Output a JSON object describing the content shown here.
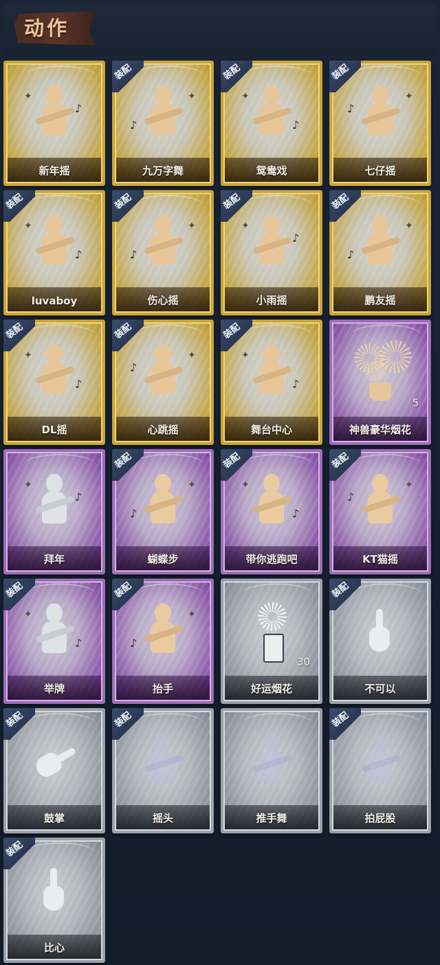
{
  "header": {
    "title": "动作"
  },
  "equip_label": "装配",
  "cards": [
    {
      "name": "新年摇",
      "rarity": "gold",
      "equipped": false,
      "icon": "figure-hands-chest-icon"
    },
    {
      "name": "九万字舞",
      "rarity": "gold",
      "equipped": true,
      "icon": "figure-swirl-icon"
    },
    {
      "name": "鸳鸯戏",
      "rarity": "gold",
      "equipped": true,
      "icon": "figure-arm-out-icon"
    },
    {
      "name": "七仔摇",
      "rarity": "gold",
      "equipped": true,
      "icon": "figure-fist-icon"
    },
    {
      "name": "luvaboy",
      "rarity": "gold",
      "equipped": true,
      "icon": "figure-cross-arms-icon"
    },
    {
      "name": "伤心摇",
      "rarity": "gold",
      "equipped": true,
      "icon": "figure-heart-hands-icon"
    },
    {
      "name": "小雨摇",
      "rarity": "gold",
      "equipped": true,
      "icon": "figure-arm-out-icon"
    },
    {
      "name": "鹏友摇",
      "rarity": "gold",
      "equipped": true,
      "icon": "figure-point-icon"
    },
    {
      "name": "DL摇",
      "rarity": "gold",
      "equipped": true,
      "icon": "figure-arm-up-icon"
    },
    {
      "name": "心跳摇",
      "rarity": "gold",
      "equipped": true,
      "icon": "figure-arm-up-icon"
    },
    {
      "name": "舞台中心",
      "rarity": "gold",
      "equipped": true,
      "icon": "figure-point-icon"
    },
    {
      "name": "神兽豪华烟花",
      "rarity": "purple",
      "equipped": false,
      "icon": "firework-pot-icon",
      "count": "5"
    },
    {
      "name": "拜年",
      "rarity": "purple",
      "equipped": false,
      "icon": "figure-greeting-icon"
    },
    {
      "name": "蝴蝶步",
      "rarity": "purple",
      "equipped": true,
      "icon": "figure-arms-wide-icon"
    },
    {
      "name": "带你逃跑吧",
      "rarity": "purple",
      "equipped": true,
      "icon": "figure-point-icon"
    },
    {
      "name": "KT猫摇",
      "rarity": "purple",
      "equipped": true,
      "icon": "figure-dance-icon"
    },
    {
      "name": "举牌",
      "rarity": "purple",
      "equipped": true,
      "icon": "figure-sign-icon"
    },
    {
      "name": "抬手",
      "rarity": "purple",
      "equipped": true,
      "icon": "figure-raise-hand-icon"
    },
    {
      "name": "好运烟花",
      "rarity": "silver",
      "equipped": false,
      "icon": "firework-can-icon",
      "count": "30"
    },
    {
      "name": "不可以",
      "rarity": "silver",
      "equipped": true,
      "icon": "finger-wag-icon"
    },
    {
      "name": "鼓掌",
      "rarity": "silver",
      "equipped": true,
      "icon": "clapping-hands-icon"
    },
    {
      "name": "摇头",
      "rarity": "silver",
      "equipped": true,
      "icon": "figure-shake-head-icon"
    },
    {
      "name": "推手舞",
      "rarity": "silver",
      "equipped": false,
      "icon": "figure-push-hands-icon"
    },
    {
      "name": "拍屁股",
      "rarity": "silver",
      "equipped": true,
      "icon": "figure-bend-icon"
    },
    {
      "name": "比心",
      "rarity": "silver",
      "equipped": true,
      "icon": "finger-heart-icon"
    }
  ]
}
